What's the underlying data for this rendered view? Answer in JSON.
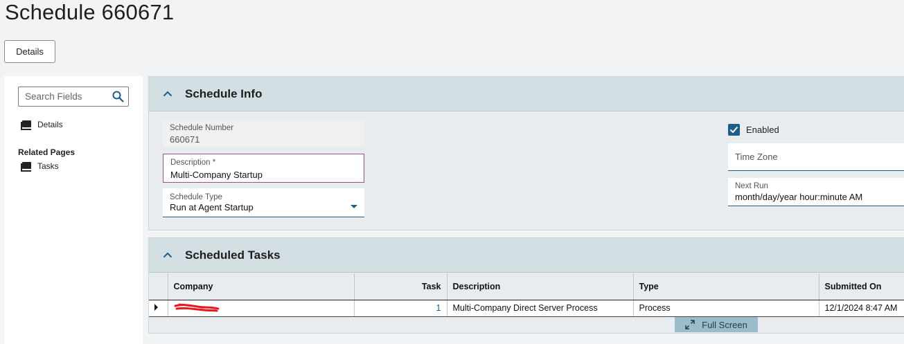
{
  "page": {
    "title": "Schedule 660671"
  },
  "toolbar": {
    "details_label": "Details"
  },
  "sidebar": {
    "search_placeholder": "Search Fields",
    "details_link": "Details",
    "related_heading": "Related Pages",
    "tasks_link": "Tasks"
  },
  "schedule_info": {
    "title": "Schedule Info",
    "schedule_number_label": "Schedule Number",
    "schedule_number_value": "660671",
    "description_label": "Description *",
    "description_value": "Multi-Company Startup",
    "schedule_type_label": "Schedule Type",
    "schedule_type_value": "Run at Agent Startup",
    "enabled_label": "Enabled",
    "enabled_checked": true,
    "time_zone_placeholder": "Time Zone",
    "next_run_label": "Next Run",
    "next_run_value": "month/day/year hour:minute AM"
  },
  "scheduled_tasks": {
    "title": "Scheduled Tasks",
    "columns": {
      "company": "Company",
      "task": "Task",
      "description": "Description",
      "type": "Type",
      "submitted_on": "Submitted On"
    },
    "rows": [
      {
        "company": "",
        "task": "1",
        "description": "Multi-Company Direct Server Process",
        "type": "Process",
        "submitted_on": "12/1/2024 8:47 AM"
      }
    ],
    "fullscreen_label": "Full Screen"
  },
  "colors": {
    "accent": "#1b5e8c",
    "panel_header": "#d3dee3",
    "focus_border": "#9a4f86",
    "redaction": "#e8191e"
  }
}
